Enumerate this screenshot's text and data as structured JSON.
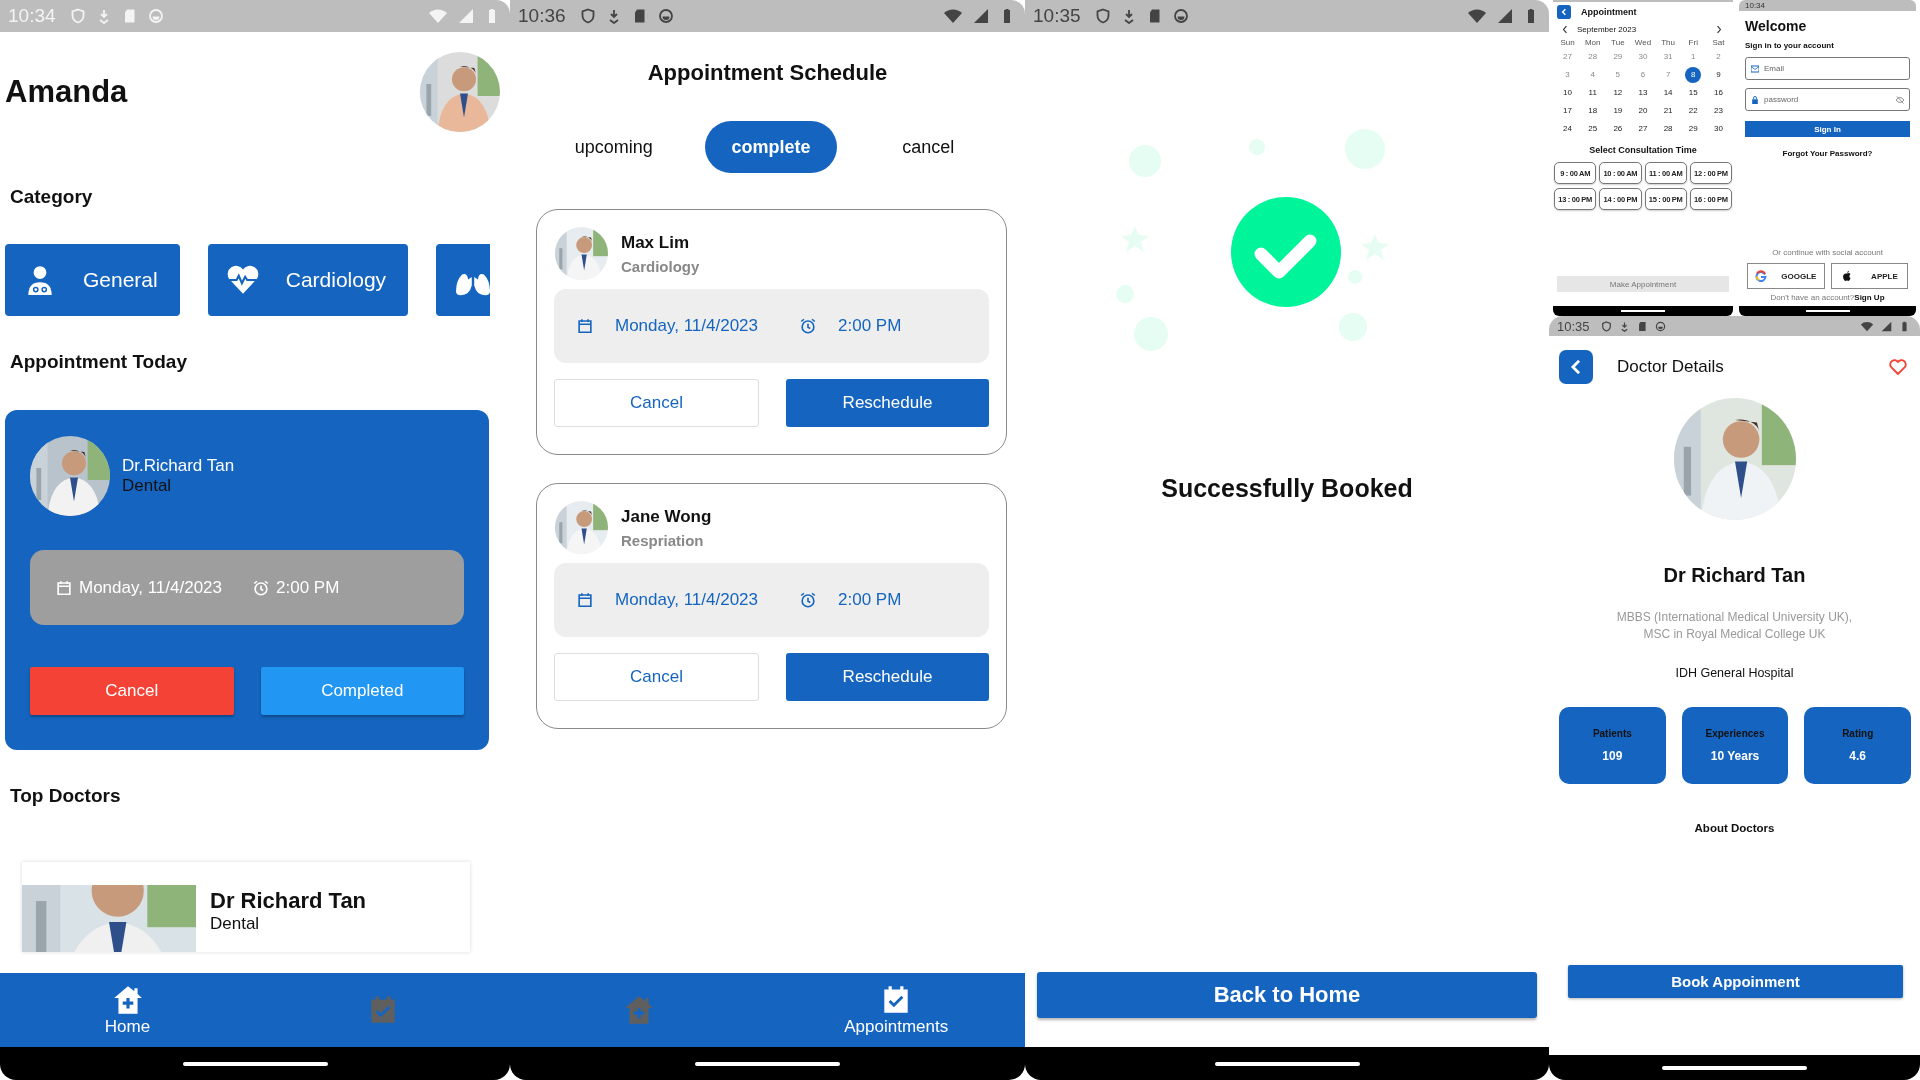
{
  "home_screen": {
    "status_time": "10:34",
    "user_name": "Amanda",
    "category_title": "Category",
    "categories": [
      {
        "kind": "general",
        "label": "General"
      },
      {
        "kind": "cardiology",
        "label": "Cardiology"
      },
      {
        "kind": "lungs"
      }
    ],
    "appointment_title": "Appointment Today",
    "appointment": {
      "doctor": "Dr.Richard Tan",
      "specialty": "Dental",
      "date": "Monday, 11/4/2023",
      "time": "2:00 PM",
      "cancel": "Cancel",
      "complete": "Completed"
    },
    "top_doctors_title": "Top Doctors",
    "top_doctors": [
      {
        "name": "Dr Richard Tan",
        "specialty": "Dental"
      }
    ],
    "bottom_nav": [
      {
        "kind": "home",
        "label": "Home",
        "selected": true
      },
      {
        "kind": "appointments",
        "selected": false
      }
    ]
  },
  "schedule_screen": {
    "status_time": "10:36",
    "title": "Appointment Schedule",
    "tabs": [
      {
        "label": "upcoming",
        "selected": false
      },
      {
        "label": "complete",
        "selected": true
      },
      {
        "label": "cancel",
        "selected": false
      }
    ],
    "appointments": [
      {
        "name": "Max Lim",
        "specialty": "Cardiology",
        "date": "Monday, 11/4/2023",
        "time": "2:00 PM",
        "cancel": "Cancel",
        "reschedule": "Reschedule"
      },
      {
        "name": "Jane Wong",
        "specialty": "Respriation",
        "date": "Monday, 11/4/2023",
        "time": "2:00 PM",
        "cancel": "Cancel",
        "reschedule": "Reschedule"
      }
    ],
    "bottom_nav": [
      {
        "kind": "home",
        "selected": false
      },
      {
        "kind": "appointments",
        "label": "Appointments",
        "selected": true
      }
    ]
  },
  "success_screen": {
    "status_time": "10:35",
    "message": "Successfully Booked",
    "button": "Back to Home"
  },
  "appointment_preview": {
    "title": "Appointment",
    "month": "September 2023",
    "weekdays": [
      "Sun",
      "Mon",
      "Tue",
      "Wed",
      "Thu",
      "Fri",
      "Sat"
    ],
    "days": [
      {
        "day": "27",
        "muted": true,
        "selected": false
      },
      {
        "day": "28",
        "muted": true,
        "selected": false
      },
      {
        "day": "29",
        "muted": true,
        "selected": false
      },
      {
        "day": "30",
        "muted": true,
        "selected": false
      },
      {
        "day": "31",
        "muted": true,
        "selected": false
      },
      {
        "day": "1",
        "muted": true,
        "selected": false
      },
      {
        "day": "2",
        "muted": true,
        "selected": false
      },
      {
        "day": "3",
        "muted": true,
        "selected": false
      },
      {
        "day": "4",
        "muted": true,
        "selected": false
      },
      {
        "day": "5",
        "muted": true,
        "selected": false
      },
      {
        "day": "6",
        "muted": true,
        "selected": false
      },
      {
        "day": "7",
        "muted": true,
        "selected": false
      },
      {
        "day": "8",
        "muted": false,
        "selected": true
      },
      {
        "day": "9",
        "muted": false,
        "selected": false
      },
      {
        "day": "10",
        "muted": false,
        "selected": false
      },
      {
        "day": "11",
        "muted": false,
        "selected": false
      },
      {
        "day": "12",
        "muted": false,
        "selected": false
      },
      {
        "day": "13",
        "muted": false,
        "selected": false
      },
      {
        "day": "14",
        "muted": false,
        "selected": false
      },
      {
        "day": "15",
        "muted": false,
        "selected": false
      },
      {
        "day": "16",
        "muted": false,
        "selected": false
      },
      {
        "day": "17",
        "muted": false,
        "selected": false
      },
      {
        "day": "18",
        "muted": false,
        "selected": false
      },
      {
        "day": "19",
        "muted": false,
        "selected": false
      },
      {
        "day": "20",
        "muted": false,
        "selected": false
      },
      {
        "day": "21",
        "muted": false,
        "selected": false
      },
      {
        "day": "22",
        "muted": false,
        "selected": false
      },
      {
        "day": "23",
        "muted": false,
        "selected": false
      },
      {
        "day": "24",
        "muted": false,
        "selected": false
      },
      {
        "day": "25",
        "muted": false,
        "selected": false
      },
      {
        "day": "26",
        "muted": false,
        "selected": false
      },
      {
        "day": "27",
        "muted": false,
        "selected": false
      },
      {
        "day": "28",
        "muted": false,
        "selected": false
      },
      {
        "day": "29",
        "muted": false,
        "selected": false
      },
      {
        "day": "30",
        "muted": false,
        "selected": false
      }
    ],
    "time_title": "Select Consultation Time",
    "time_slots": [
      "9 : 00 AM",
      "10 : 00 AM",
      "11 : 00 AM",
      "12 : 00 PM",
      "13 : 00 PM",
      "14 : 00 PM",
      "15 : 00 PM",
      "16 : 00 PM"
    ],
    "button": {
      "label": "Make Appointment",
      "disabled": true
    }
  },
  "login_preview": {
    "status_time": "10:34",
    "title": "Welcome",
    "subtitle": "Sign in to your account",
    "email": {
      "placeholder": "Email"
    },
    "password": {
      "placeholder": "password"
    },
    "sign_in": "Sign In",
    "forgot": "Forgot Your Password?",
    "social_label": "Or continue with social account",
    "social_buttons": [
      {
        "kind": "google",
        "label": "GOOGLE"
      },
      {
        "kind": "apple",
        "label": "APPLE"
      }
    ],
    "signup_prompt": "Don't have an account?",
    "signup_link": "Sign Up"
  },
  "doctor_details_screen": {
    "status_time": "10:35",
    "title": "Doctor Details",
    "name": "Dr Richard Tan",
    "qualifications": [
      "MBBS (International Medical University UK),",
      "MSC in Royal Medical College UK"
    ],
    "hospital": "IDH General Hospital",
    "stats": [
      {
        "label": "Patients",
        "value": "109"
      },
      {
        "label": "Experiences",
        "value": "10 Years"
      },
      {
        "label": "Rating",
        "value": "4.6"
      }
    ],
    "about_title": "About Doctors",
    "button": "Book Appoinment"
  }
}
